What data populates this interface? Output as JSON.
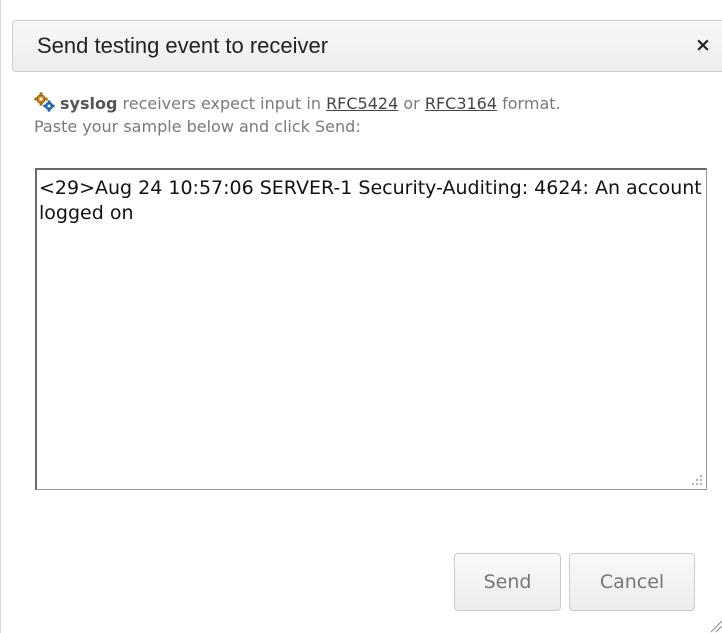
{
  "dialog": {
    "title": "Send testing event to receiver",
    "close_label": "×"
  },
  "info": {
    "icon": "gears-icon",
    "receiver_type": "syslog",
    "text_before_links": " receivers expect input in ",
    "link1": "RFC5424",
    "text_between": " or ",
    "link2": "RFC3164",
    "text_after": " format.",
    "line2": "Paste your sample below and click Send:"
  },
  "sample": {
    "value": "<29>Aug 24 10:57:06 SERVER-1 Security-Auditing: 4624: An account logged on"
  },
  "buttons": {
    "send_label": "Send",
    "cancel_label": "Cancel"
  },
  "colors": {
    "title_text": "#222222",
    "muted_text": "#7a7a7a",
    "button_text": "#777777",
    "border": "#c9cdd1"
  }
}
